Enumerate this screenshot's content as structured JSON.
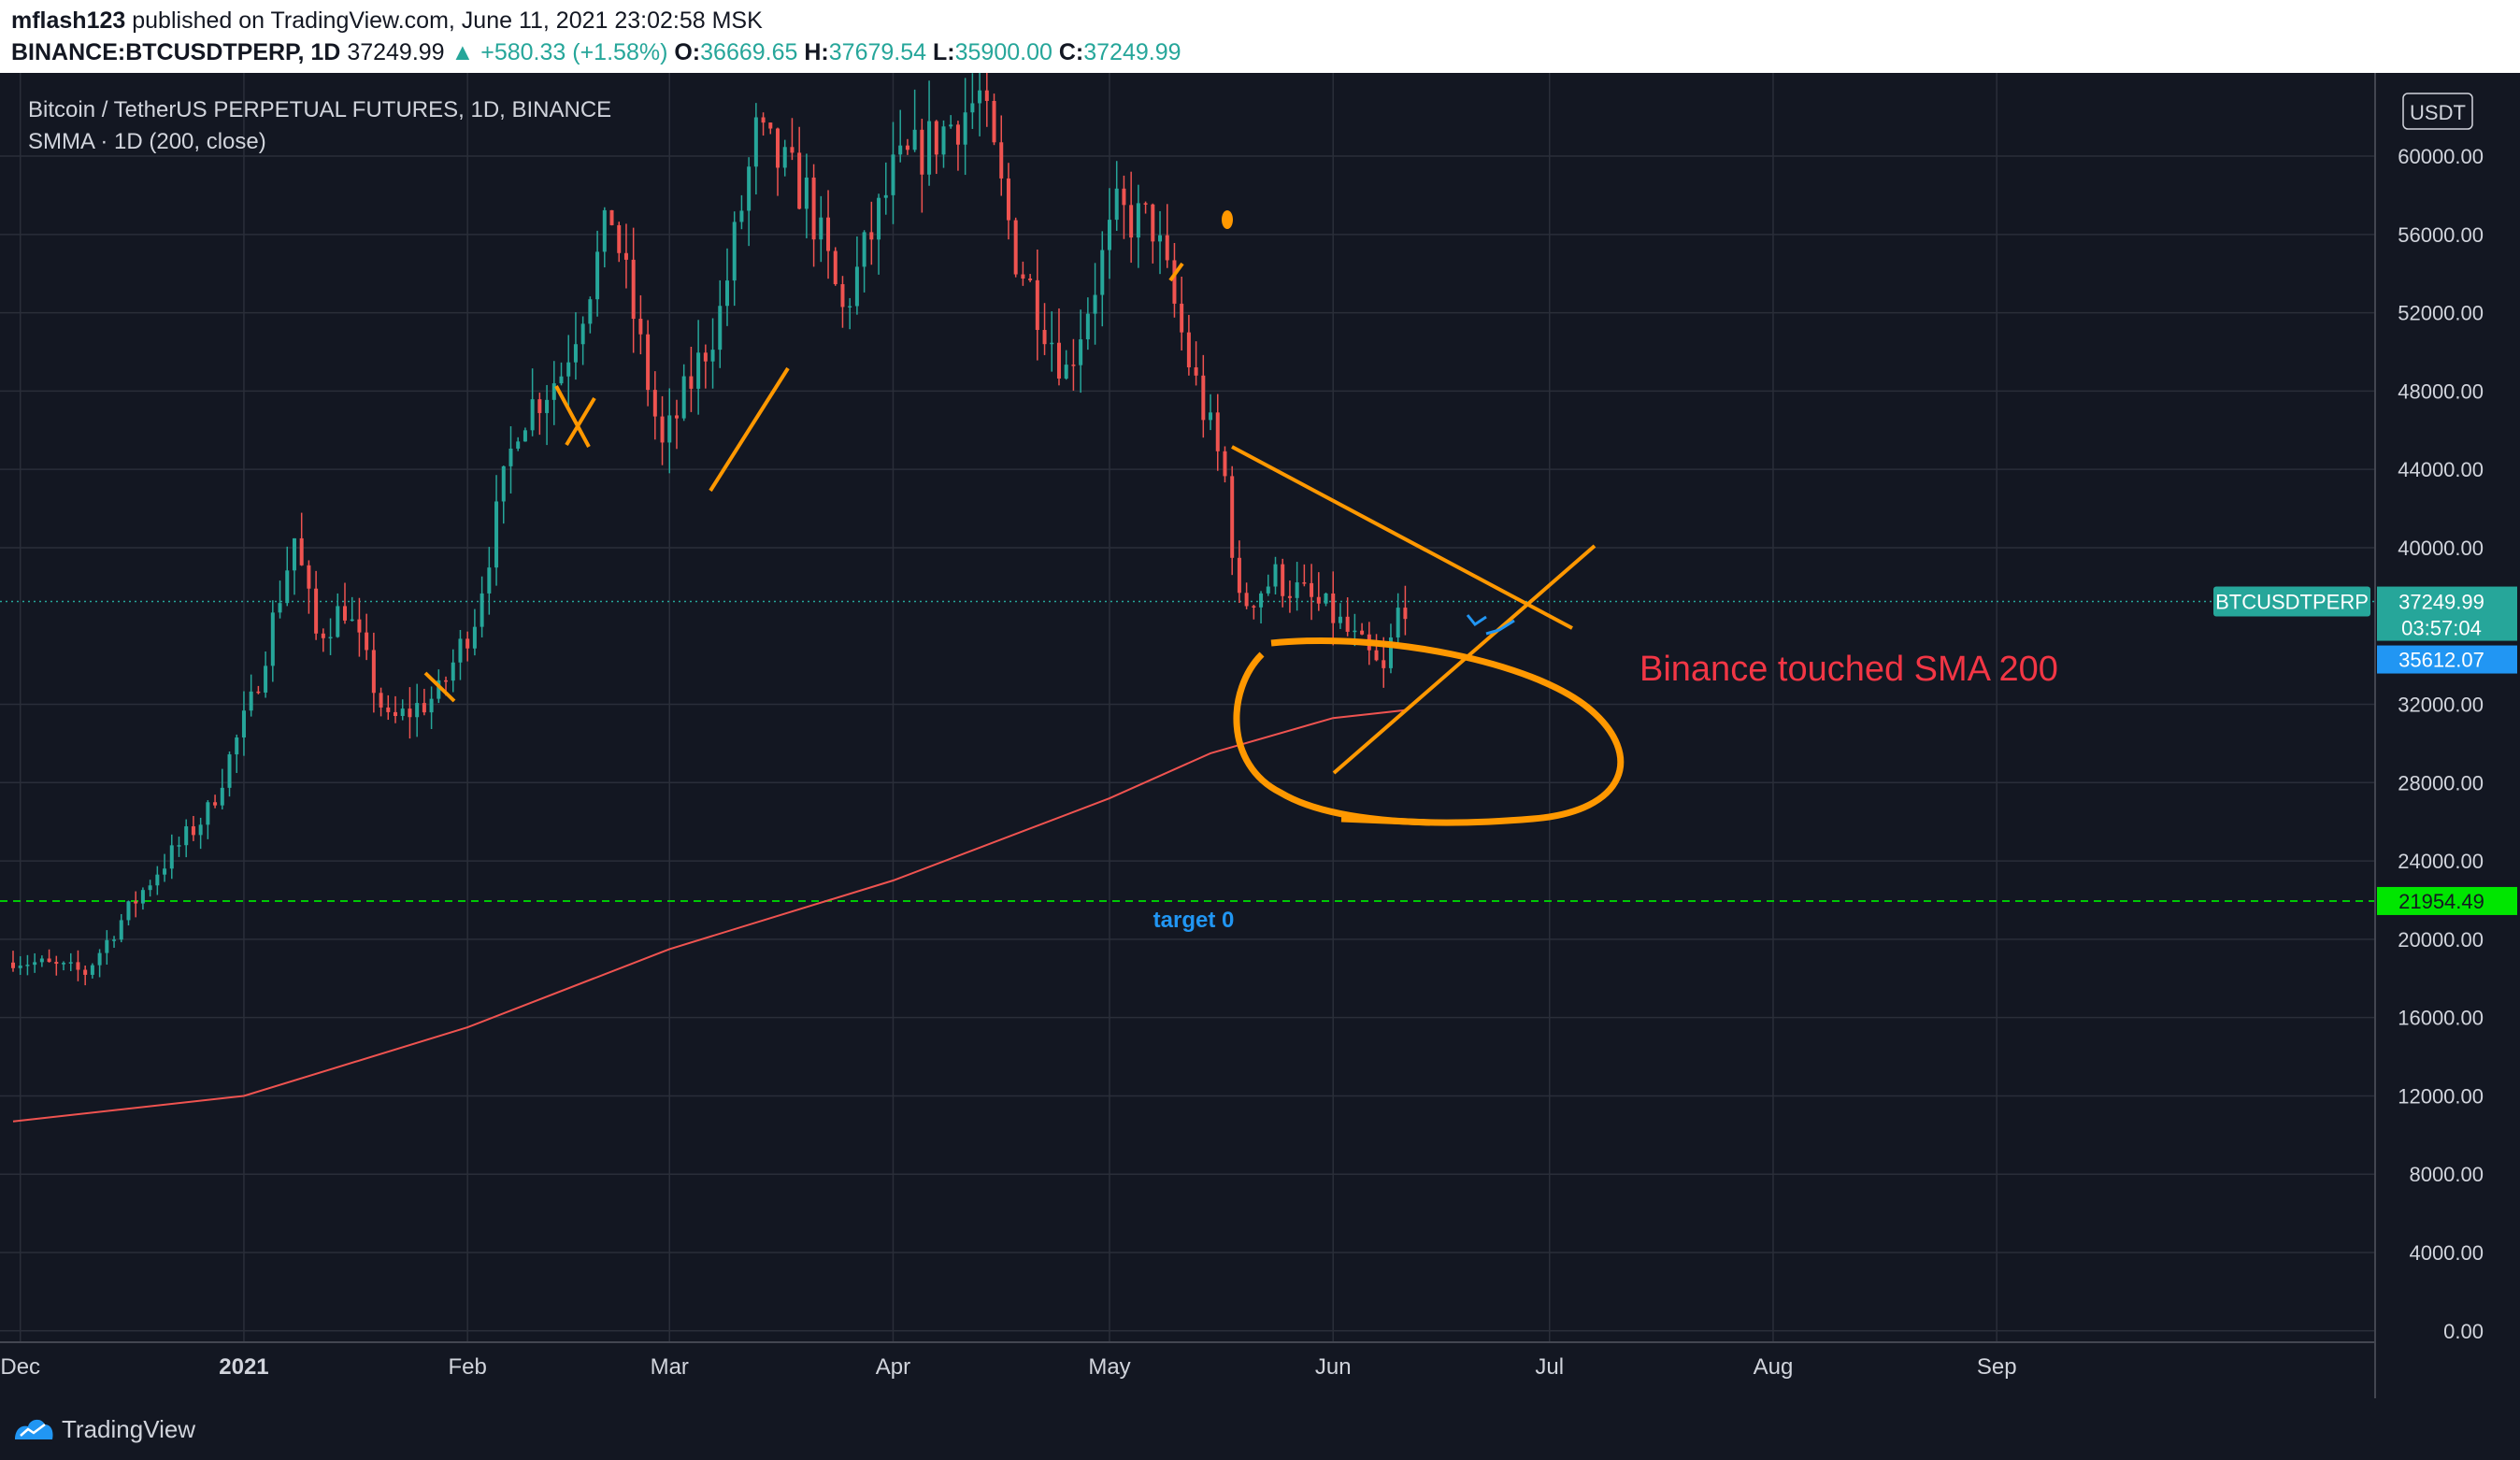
{
  "header": {
    "author": "mflash123",
    "published_text": "published on TradingView.com, June 11, 2021 23:02:58 MSK",
    "symbol": "BINANCE:BTCUSDTPERP, 1D",
    "last": "37249.99",
    "change": "+580.33 (+1.58%)",
    "o_label": "O:",
    "o_value": "36669.65",
    "h_label": "H:",
    "h_value": "37679.54",
    "l_label": "L:",
    "l_value": "35900.00",
    "c_label": "C:",
    "c_value": "37249.99"
  },
  "legend": {
    "title": "Bitcoin / TetherUS PERPETUAL FUTURES, 1D, BINANCE",
    "indicator": "SMMA · 1D (200, close)"
  },
  "price_scale": {
    "currency": "USDT",
    "symbol_tag": "BTCUSDTPERP",
    "last_price": "37249.99",
    "countdown": "03:57:04",
    "smma_price": "35612.07",
    "line_price": "21954.49"
  },
  "annotations": {
    "text": "Binance touched SMA 200",
    "target": "target 0"
  },
  "footer": {
    "brand": "TradingView"
  },
  "colors": {
    "background": "#131722",
    "grid": "#2a2e39",
    "up": "#26a69a",
    "down": "#ef5350",
    "smma": "#ef5350",
    "drawing": "#ff9800",
    "target_line": "#00c805",
    "last_price_tag": "#26a69a",
    "smma_tag": "#2196f3",
    "annotation_text": "#f23645",
    "target_text": "#2196f3"
  },
  "chart_data": {
    "type": "candlestick",
    "x_axis_labels": [
      "Dec",
      "2021",
      "Feb",
      "Mar",
      "Apr",
      "May",
      "Jun",
      "Jul",
      "Aug",
      "Sep"
    ],
    "x_axis_dates": [
      "2020-12-01",
      "2021-01-01",
      "2021-02-01",
      "2021-03-01",
      "2021-04-01",
      "2021-05-01",
      "2021-06-01",
      "2021-07-01",
      "2021-08-01",
      "2021-09-01"
    ],
    "y_ticks": [
      "60000.00",
      "56000.00",
      "52000.00",
      "48000.00",
      "44000.00",
      "40000.00",
      "32000.00",
      "28000.00",
      "24000.00",
      "20000.00",
      "16000.00",
      "12000.00",
      "8000.00",
      "4000.00",
      "0.00"
    ],
    "y_tick_values": [
      60000,
      56000,
      52000,
      48000,
      44000,
      40000,
      32000,
      28000,
      24000,
      20000,
      16000,
      12000,
      8000,
      4000,
      0
    ],
    "y_range": [
      -200,
      63200
    ],
    "x_range": [
      "2020-11-30",
      "2021-09-30"
    ],
    "grid": true,
    "close_anchors": [
      [
        "2020-11-30",
        19000
      ],
      [
        "2020-12-10",
        18300
      ],
      [
        "2020-12-16",
        21500
      ],
      [
        "2020-12-20",
        23500
      ],
      [
        "2020-12-27",
        26500
      ],
      [
        "2021-01-02",
        32000
      ],
      [
        "2021-01-08",
        40500
      ],
      [
        "2021-01-11",
        35500
      ],
      [
        "2021-01-15",
        37000
      ],
      [
        "2021-01-21",
        31000
      ],
      [
        "2021-01-28",
        32500
      ],
      [
        "2021-02-02",
        36500
      ],
      [
        "2021-02-08",
        46500
      ],
      [
        "2021-02-14",
        49000
      ],
      [
        "2021-02-21",
        57000
      ],
      [
        "2021-02-28",
        45000
      ],
      [
        "2021-03-08",
        52000
      ],
      [
        "2021-03-13",
        61000
      ],
      [
        "2021-03-20",
        58000
      ],
      [
        "2021-03-25",
        52000
      ],
      [
        "2021-04-01",
        59000
      ],
      [
        "2021-04-13",
        63000
      ],
      [
        "2021-04-18",
        55000
      ],
      [
        "2021-04-25",
        49000
      ],
      [
        "2021-05-02",
        57000
      ],
      [
        "2021-05-07",
        56500
      ],
      [
        "2021-05-12",
        49500
      ],
      [
        "2021-05-17",
        43500
      ],
      [
        "2021-05-19",
        37000
      ],
      [
        "2021-05-24",
        38500
      ],
      [
        "2021-06-01",
        36500
      ],
      [
        "2021-06-08",
        33500
      ],
      [
        "2021-06-10",
        36700
      ],
      [
        "2021-06-11",
        37250
      ]
    ],
    "smma_anchors": [
      [
        "2020-11-30",
        10700
      ],
      [
        "2021-01-01",
        12000
      ],
      [
        "2021-02-01",
        15500
      ],
      [
        "2021-03-01",
        19500
      ],
      [
        "2021-04-01",
        23000
      ],
      [
        "2021-05-01",
        27200
      ],
      [
        "2021-05-15",
        29500
      ],
      [
        "2021-06-01",
        31300
      ],
      [
        "2021-06-11",
        31700
      ]
    ],
    "horizontal_line": {
      "price": 21954.49,
      "style": "dashed"
    },
    "last_price_line": {
      "price": 37249.99,
      "style": "dotted"
    }
  }
}
